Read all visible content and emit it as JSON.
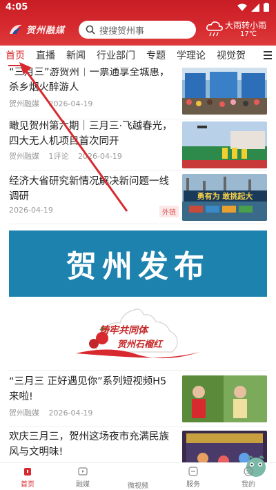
{
  "status_bar": {
    "time": "4:05"
  },
  "header": {
    "logo_text": "贺州融媒",
    "search_placeholder": "搜搜贺州事",
    "weather": {
      "desc": "大雨转小雨",
      "temp": "17℃"
    }
  },
  "tabs": [
    "首页",
    "直播",
    "新闻",
    "行业部门",
    "专题",
    "学理论",
    "视觉贺"
  ],
  "news": [
    {
      "title": "“三月三”游贺州｜一票通享全城惠，杀乡烟火醉游人",
      "source": "贺州融媒",
      "date": "2026-04-19",
      "comments": ""
    },
    {
      "title": "瞰见贺州第六期｜三月三·飞越春光，四大无人机项目首次同开",
      "source": "贺州融媒",
      "comments": "1评论",
      "date": "2026-04-19"
    },
    {
      "title": "经济大省研究新情况解决新问题一线调研",
      "date": "2026-04-19",
      "tag": "外链"
    },
    {
      "title": "“三月三 正好遇见你”系列短视频H5来啦!",
      "source": "贺州融媒",
      "date": "2026-04-19"
    },
    {
      "title": "欢庆三月三，贺州这场夜市充满民族风与文明味!",
      "source": "",
      "date": ""
    }
  ],
  "thumb_texts": {
    "port_sign": "勇有为 敢挑起大"
  },
  "banner": {
    "text": "贺州发布"
  },
  "promo": {
    "line1": "铸牢共同体",
    "line2": "贺州石榴红"
  },
  "bottom_nav": [
    {
      "label": "首页",
      "active": true
    },
    {
      "label": "融媒",
      "active": false
    },
    {
      "label": "微视频",
      "active": false
    },
    {
      "label": "服务",
      "active": false
    },
    {
      "label": "我的",
      "active": false
    }
  ],
  "colors": {
    "brand_red": "#d8292e",
    "banner_blue": "#1d83ae"
  }
}
